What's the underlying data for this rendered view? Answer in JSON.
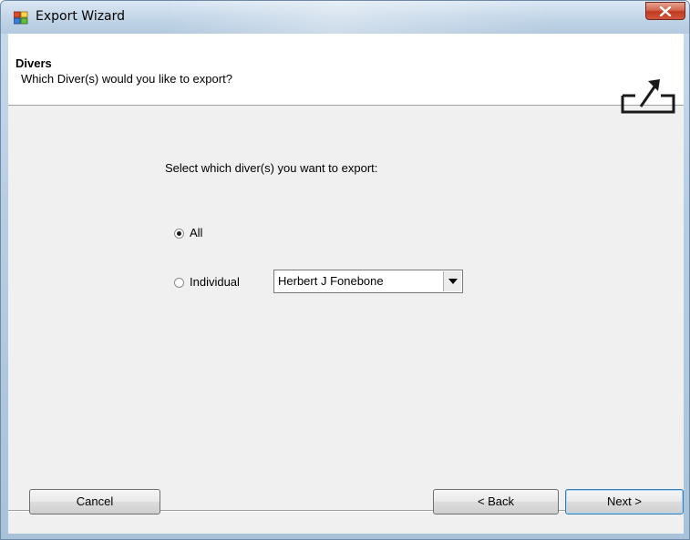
{
  "window": {
    "title": "Export Wizard",
    "close_icon": "close-icon"
  },
  "header": {
    "title": "Divers",
    "subtitle": "Which Diver(s) would you like to export?",
    "icon": "export-icon"
  },
  "main": {
    "prompt": "Select which diver(s) you want to export:",
    "options": [
      {
        "label": "All",
        "selected": true
      },
      {
        "label": "Individual",
        "selected": false
      }
    ],
    "diver_select": {
      "value": "Herbert J Fonebone"
    }
  },
  "footer": {
    "cancel_label": "Cancel",
    "back_label": "< Back",
    "next_label": "Next >"
  },
  "colors": {
    "title_bar": "#c3d6e8",
    "close_button": "#c0391f",
    "client_bg": "#f0f0f0",
    "header_bg": "#ffffff"
  }
}
